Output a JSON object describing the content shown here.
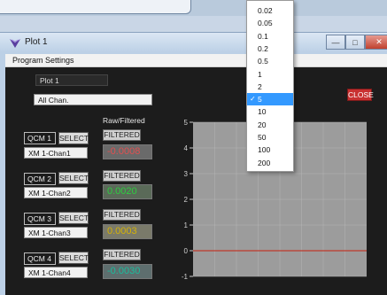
{
  "window": {
    "title": "Plot 1"
  },
  "menubar": {
    "items": [
      "Program Settings"
    ]
  },
  "settings": {
    "plot_name": "Plot 1",
    "channel_mode": "All Chan.",
    "close_label": "CLOSE",
    "raw_filtered_label": "Raw/Filtered"
  },
  "channels": [
    {
      "qcm": "QCM 1",
      "select": "SELECT",
      "mode": "FILTERED",
      "name": "XM 1-Chan1",
      "value": "-0.0008",
      "value_color": "#e05050"
    },
    {
      "qcm": "QCM 2",
      "select": "SELECT",
      "mode": "FILTERED",
      "name": "XM 1-Chan2",
      "value": "0.0020",
      "value_color": "#2ecc40"
    },
    {
      "qcm": "QCM 3",
      "select": "SELECT",
      "mode": "FILTERED",
      "name": "XM 1-Chan3",
      "value": "0.0003",
      "value_color": "#d4b106"
    },
    {
      "qcm": "QCM 4",
      "select": "SELECT",
      "mode": "FILTERED",
      "name": "XM 1-Chan4",
      "value": "-0.0030",
      "value_color": "#1abc9c"
    }
  ],
  "plot": {
    "y_ticks": [
      "5",
      "4",
      "3",
      "2",
      "1",
      "0",
      "-1"
    ],
    "line_color": "#c0392b",
    "background": "#9c9c9c",
    "grid_color": "#b5b5b5",
    "line_value": 0
  },
  "dropdown": {
    "options": [
      "0.02",
      "0.05",
      "0.1",
      "0.2",
      "0.5",
      "1",
      "2",
      "5",
      "10",
      "20",
      "50",
      "100",
      "200"
    ],
    "selected": "5",
    "check_mark": "✓"
  }
}
